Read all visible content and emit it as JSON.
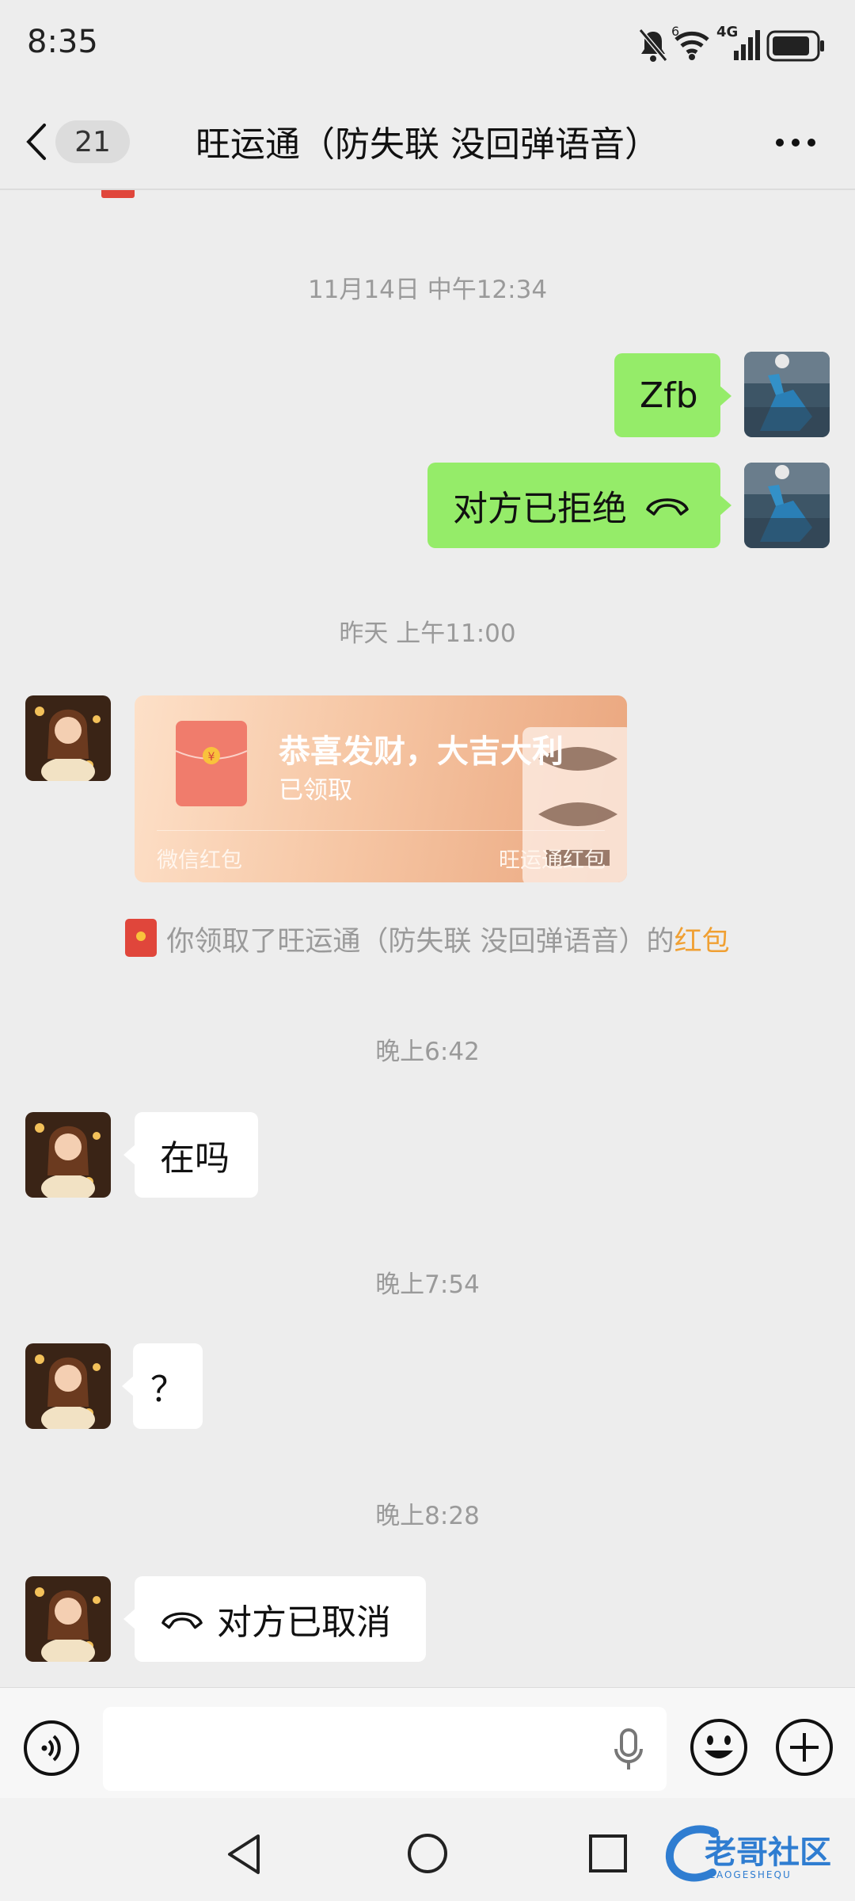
{
  "status_bar": {
    "time": "8:35",
    "network_label": "4G",
    "sim_index": "6"
  },
  "header": {
    "unread_count": "21",
    "title": "旺运通（防失联 没回弹语音）"
  },
  "messages": [
    {
      "type": "timestamp",
      "text": "11月14日 中午12:34"
    },
    {
      "type": "sent",
      "text": "Zfb"
    },
    {
      "type": "sent_call",
      "text": "对方已拒绝"
    },
    {
      "type": "timestamp",
      "text": "昨天 上午11:00"
    },
    {
      "type": "red_packet",
      "title": "恭喜发财，大吉大利",
      "status": "已领取",
      "footer_left": "微信红包",
      "footer_right": "旺运通红包"
    },
    {
      "type": "system",
      "text": "你领取了旺运通（防失联 没回弹语音）的",
      "link": "红包"
    },
    {
      "type": "timestamp",
      "text": "晚上6:42"
    },
    {
      "type": "received",
      "text": "在吗"
    },
    {
      "type": "timestamp",
      "text": "晚上7:54"
    },
    {
      "type": "received",
      "text": "？"
    },
    {
      "type": "timestamp",
      "text": "晚上8:28"
    },
    {
      "type": "received_call",
      "text": "对方已取消"
    }
  ],
  "input_bar": {
    "voice_icon": "voice-mode-icon",
    "mic_icon": "microphone-icon",
    "emoji_icon": "emoji-icon",
    "plus_icon": "plus-icon"
  },
  "watermark": {
    "text": "老哥社区",
    "subtext": "LAOGESHEQU"
  },
  "colors": {
    "sent_bubble": "#95ec69",
    "received_bubble": "#ffffff",
    "background": "#ededed",
    "red_packet_link": "#f0a033"
  }
}
